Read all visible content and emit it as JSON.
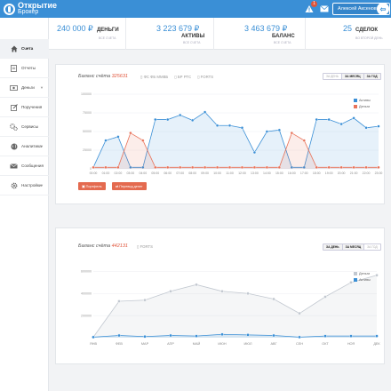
{
  "header": {
    "logo_line1": "Открытие",
    "logo_line2": "Брокер",
    "notifications_count": "1",
    "user_name": "Алексей Аксенов",
    "icons": [
      "warning-icon",
      "mail-icon",
      "logout-icon"
    ]
  },
  "stats": [
    {
      "value": "240 000 ₽",
      "label": "ДЕНЬГИ",
      "sub": "ВСЕ СЧЕТА"
    },
    {
      "value": "3 223 679 ₽",
      "label": "АКТИВЫ",
      "sub": "ВСЕ СЧЕТА"
    },
    {
      "value": "3 463 679 ₽",
      "label": "БАЛАНС",
      "sub": "ВСЕ СЧЕТА"
    },
    {
      "value": "25",
      "label": "СДЕЛОК",
      "sub": "ВО ВТОРОЙ ДЕНЬ"
    }
  ],
  "sidebar": {
    "items": [
      {
        "label": "Счета",
        "icon": "home-icon",
        "active": true
      },
      {
        "label": "Отчеты",
        "icon": "document-icon"
      },
      {
        "label": "Деньги",
        "icon": "money-icon",
        "caret": true
      },
      {
        "label": "Поручения",
        "icon": "edit-icon"
      },
      {
        "label": "Сервисы",
        "icon": "gears-icon"
      },
      {
        "label": "Аналитика",
        "icon": "globe-icon",
        "caret": true
      },
      {
        "label": "Сообщения",
        "icon": "envelope-icon"
      },
      {
        "label": "Настройки",
        "icon": "gear-icon",
        "caret": true
      }
    ]
  },
  "card1": {
    "title_prefix": "Баланс счёта",
    "account": "325631",
    "markets": [
      "ФС ФБ ММВБ",
      "БР РТС",
      "FORTS"
    ],
    "periods": [
      "ЗА ДЕНЬ",
      "ЗА МЕСЯЦ",
      "ЗА ГОД"
    ],
    "active_period": 0,
    "buttons": [
      "Портфель",
      "Перевод денег"
    ]
  },
  "card2": {
    "title_prefix": "Баланс счёта",
    "account": "442131",
    "markets": [
      "FORTS"
    ],
    "periods": [
      "ЗА ДЕНЬ",
      "ЗА МЕСЯЦ",
      "ЗА ГОД"
    ],
    "active_period": 1
  },
  "colors": {
    "blue": "#3a8fd6",
    "red": "#e8735a",
    "gray": "#c2c8d0",
    "accent": "#e0543a"
  },
  "chart_data": [
    {
      "type": "area",
      "categories": [
        "00:00",
        "01:00",
        "02:00",
        "03:00",
        "04:00",
        "05:00",
        "06:00",
        "07:00",
        "08:00",
        "09:00",
        "10:00",
        "11:00",
        "12:00",
        "13:00",
        "14:00",
        "15:00",
        "16:00",
        "17:00",
        "18:00",
        "19:00",
        "20:00",
        "21:00",
        "22:00",
        "23:00"
      ],
      "ylim": [
        0,
        100000
      ],
      "yticks": [
        "0",
        "25000",
        "50000",
        "75000",
        "100000"
      ],
      "series": [
        {
          "name": "Активы",
          "color": "#3a8fd6",
          "values": [
            2000,
            38000,
            43000,
            2000,
            2000,
            66000,
            66000,
            72000,
            65000,
            76000,
            58000,
            58000,
            55000,
            22000,
            50000,
            52000,
            2000,
            2000,
            66000,
            66000,
            60000,
            68000,
            55000,
            57000
          ]
        },
        {
          "name": "Деньги",
          "color": "#e8735a",
          "values": [
            2000,
            2000,
            2000,
            48000,
            38000,
            2000,
            2000,
            2000,
            2000,
            2000,
            2000,
            2000,
            2000,
            2000,
            2000,
            2000,
            48000,
            38000,
            2000,
            2000,
            2000,
            2000,
            2000,
            2000
          ]
        }
      ]
    },
    {
      "type": "area",
      "categories": [
        "ЯНВ",
        "ФЕВ",
        "МАР",
        "АПР",
        "МАЙ",
        "ИЮН",
        "ИЮЛ",
        "АВГ",
        "СЕН",
        "ОКТ",
        "НОЯ",
        "ДЕК"
      ],
      "ylim": [
        0,
        700000
      ],
      "yticks": [
        "200000",
        "400000",
        "600000"
      ],
      "series": [
        {
          "name": "Деньги",
          "color": "#c2c8d0",
          "values": [
            5000,
            330000,
            340000,
            420000,
            480000,
            420000,
            400000,
            350000,
            220000,
            370000,
            500000,
            565000
          ]
        },
        {
          "name": "Активы",
          "color": "#3a8fd6",
          "values": [
            5000,
            20000,
            10000,
            20000,
            15000,
            30000,
            25000,
            20000,
            5000,
            15000,
            15000,
            15000
          ]
        }
      ]
    }
  ]
}
